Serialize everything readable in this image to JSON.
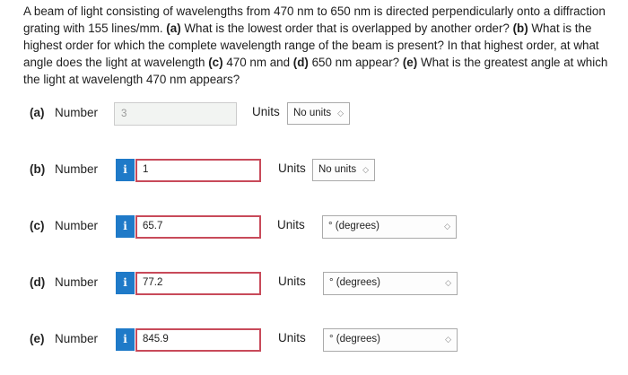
{
  "question": {
    "p1": "A beam of light consisting of wavelengths from 470 nm to 650 nm is directed perpendicularly onto a diffraction grating with 155 lines/mm. ",
    "a_tag": "(a)",
    "a_text": " What is the lowest order that is overlapped by another order? ",
    "b_tag": "(b)",
    "b_text": " What is the highest order for which the complete wavelength range of the beam is present? In that highest order, at what angle does the light at wavelength ",
    "c_tag": "(c)",
    "c_text": " 470 nm and ",
    "d_tag": "(d)",
    "d_text": " 650 nm appear? ",
    "e_tag": "(e)",
    "e_text": " What is the greatest angle at which the light at wavelength 470 nm appears?"
  },
  "common": {
    "number_label": "Number",
    "units_label": "Units",
    "info_glyph": "i",
    "chevron": "◇"
  },
  "answers": [
    {
      "part": "(a)",
      "value": "3",
      "unit": "No units"
    },
    {
      "part": "(b)",
      "value": "1",
      "unit": "No units"
    },
    {
      "part": "(c)",
      "value": "65.7",
      "unit": "° (degrees)"
    },
    {
      "part": "(d)",
      "value": "77.2",
      "unit": "° (degrees)"
    },
    {
      "part": "(e)",
      "value": "845.9",
      "unit": "° (degrees)"
    }
  ]
}
